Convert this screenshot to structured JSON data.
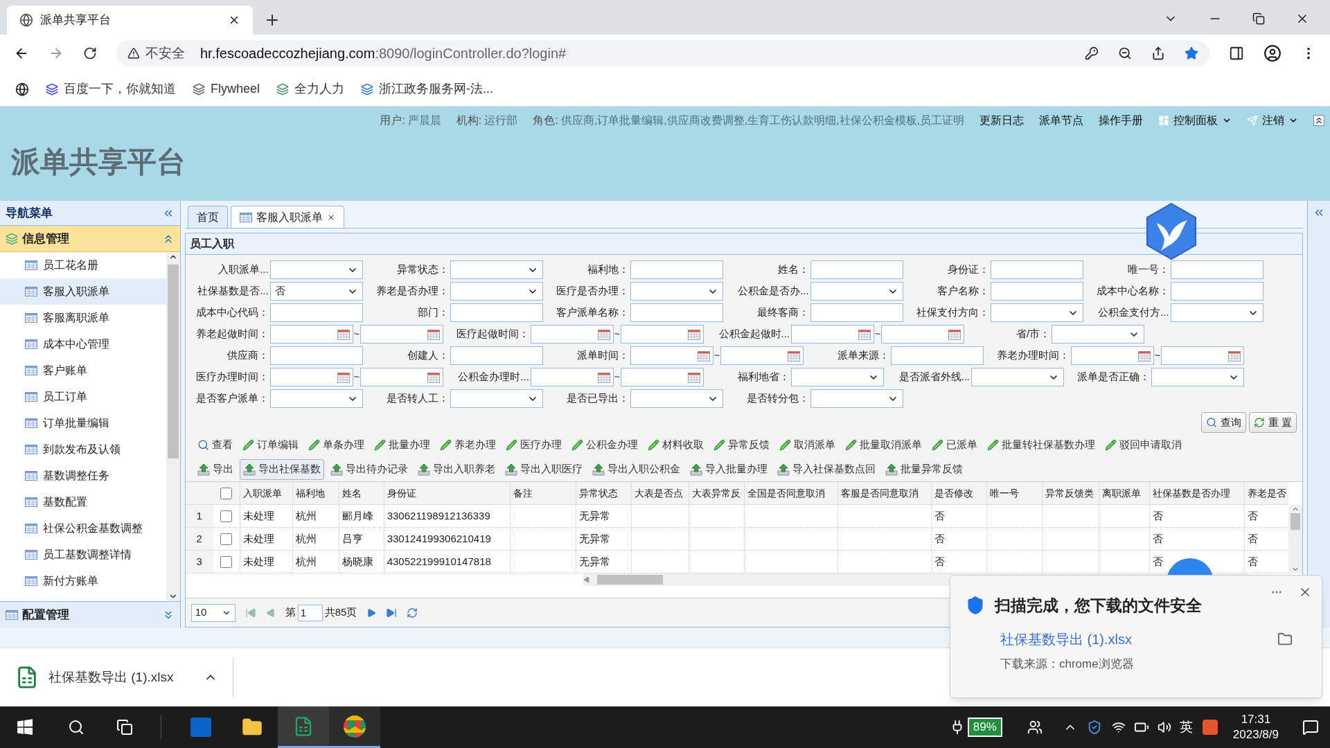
{
  "browser": {
    "tab_title": "派单共享平台",
    "security": "不安全",
    "url_host": "hr.fescoadeccozhejiang.com",
    "url_rest": ":8090/loginController.do?login#",
    "bookmarks": [
      "百度一下，你就知道",
      "Flywheel",
      "全力人力",
      "浙江政务服务网-法..."
    ]
  },
  "header": {
    "title": "派单共享平台",
    "info": [
      {
        "label": "用户:",
        "value": "严晨晨"
      },
      {
        "label": "机构:",
        "value": "运行部"
      },
      {
        "label": "角色:",
        "value": "供应商,订单批量编辑,供应商改费调整,生育工伤认款明细,社保公积金模板,员工证明"
      }
    ],
    "links": [
      {
        "label": "更新日志",
        "kind": "plain"
      },
      {
        "label": "派单节点",
        "kind": "plain"
      },
      {
        "label": "操作手册",
        "kind": "plain"
      },
      {
        "label": "控制面板",
        "kind": "panel"
      },
      {
        "label": "注销",
        "kind": "logout"
      }
    ]
  },
  "sidebar": {
    "title": "导航菜单",
    "groups": [
      {
        "label": "信息管理",
        "expanded": true,
        "items": [
          {
            "label": "员工花名册",
            "selected": false
          },
          {
            "label": "客服入职派单",
            "selected": true
          },
          {
            "label": "客服离职派单",
            "selected": false
          },
          {
            "label": "成本中心管理",
            "selected": false
          },
          {
            "label": "客户账单",
            "selected": false
          },
          {
            "label": "员工订单",
            "selected": false
          },
          {
            "label": "订单批量编辑",
            "selected": false
          },
          {
            "label": "到款发布及认领",
            "selected": false
          },
          {
            "label": "基数调整任务",
            "selected": false
          },
          {
            "label": "基数配置",
            "selected": false
          },
          {
            "label": "社保公积金基数调整",
            "selected": false
          },
          {
            "label": "员工基数调整详情",
            "selected": false
          },
          {
            "label": "新付方账单",
            "selected": false
          }
        ]
      },
      {
        "label": "配置管理",
        "expanded": false
      }
    ]
  },
  "tabs": [
    {
      "label": "首页",
      "selected": false,
      "closable": false
    },
    {
      "label": "客服入职派单",
      "selected": true,
      "closable": true
    }
  ],
  "panel": {
    "title": "员工入职",
    "form_rows": [
      [
        {
          "label": "入职派单...",
          "kind": "select"
        },
        {
          "label": "异常状态：",
          "kind": "select"
        },
        {
          "label": "福利地：",
          "kind": "text"
        },
        {
          "label": "姓名：",
          "kind": "text"
        },
        {
          "label": "身份证：",
          "kind": "text"
        },
        {
          "label": "唯一号：",
          "kind": "text"
        }
      ],
      [
        {
          "label": "社保基数是否...",
          "kind": "select",
          "value": "否"
        },
        {
          "label": "养老是否办理：",
          "kind": "select"
        },
        {
          "label": "医疗是否办理：",
          "kind": "select"
        },
        {
          "label": "公积金是否办...",
          "kind": "select"
        },
        {
          "label": "客户名称：",
          "kind": "text"
        },
        {
          "label": "成本中心名称：",
          "kind": "text"
        }
      ],
      [
        {
          "label": "成本中心代码：",
          "kind": "text"
        },
        {
          "label": "部门：",
          "kind": "text"
        },
        {
          "label": "客户派单名称：",
          "kind": "text"
        },
        {
          "label": "最终客商：",
          "kind": "text"
        },
        {
          "label": "社保支付方向：",
          "kind": "select"
        },
        {
          "label": "公积金支付方...",
          "kind": "select"
        }
      ],
      [
        {
          "label": "养老起做时间：",
          "kind": "daterange",
          "separator": "~"
        },
        {
          "label": "医疗起做时间：",
          "kind": "daterange",
          "separator": "~"
        },
        {
          "label": "公积金起做时...",
          "kind": "daterange",
          "separator": "~"
        },
        {
          "label": "省/市：",
          "kind": "select"
        }
      ],
      [
        {
          "label": "供应商：",
          "kind": "text"
        },
        {
          "label": "创建人：",
          "kind": "text"
        },
        {
          "label": "派单时间：",
          "kind": "daterange",
          "separator": "~"
        },
        {
          "label": "派单来源：",
          "kind": "text"
        },
        {
          "label": "养老办理时间：",
          "kind": "daterange",
          "separator": "~"
        }
      ],
      [
        {
          "label": "医疗办理时间：",
          "kind": "daterange",
          "separator": "~"
        },
        {
          "label": "公积金办理时...",
          "kind": "daterange",
          "separator": "~"
        },
        {
          "label": "福利地省：",
          "kind": "select"
        },
        {
          "label": "是否派省外线...",
          "kind": "select"
        },
        {
          "label": "派单是否正确：",
          "kind": "select"
        }
      ],
      [
        {
          "label": "是否客户派单：",
          "kind": "select"
        },
        {
          "label": "是否转人工：",
          "kind": "select"
        },
        {
          "label": "是否已导出：",
          "kind": "select"
        },
        {
          "label": "是否转分包：",
          "kind": "select"
        }
      ]
    ],
    "form_buttons": [
      {
        "label": "查询",
        "kind": "search"
      },
      {
        "label": "重 置",
        "kind": "reset"
      }
    ],
    "toolbar_rows": [
      [
        {
          "label": "查看",
          "kind": "view",
          "focused": false
        },
        {
          "label": "订单编辑",
          "kind": "edit",
          "focused": false
        },
        {
          "label": "单条办理",
          "kind": "edit",
          "focused": false
        },
        {
          "label": "批量办理",
          "kind": "edit",
          "focused": false
        },
        {
          "label": "养老办理",
          "kind": "edit",
          "focused": false
        },
        {
          "label": "医疗办理",
          "kind": "edit",
          "focused": false
        },
        {
          "label": "公积金办理",
          "kind": "edit",
          "focused": false
        },
        {
          "label": "材料收取",
          "kind": "edit",
          "focused": false
        },
        {
          "label": "异常反馈",
          "kind": "edit",
          "focused": false
        },
        {
          "label": "取消派单",
          "kind": "edit",
          "focused": false
        },
        {
          "label": "批量取消派单",
          "kind": "edit",
          "focused": false
        },
        {
          "label": "已派单",
          "kind": "edit",
          "focused": false
        },
        {
          "label": "批量转社保基数办理",
          "kind": "edit",
          "focused": false
        },
        {
          "label": "驳回申请取消",
          "kind": "edit",
          "focused": false
        }
      ],
      [
        {
          "label": "导出",
          "kind": "export",
          "focused": false
        },
        {
          "label": "导出社保基数",
          "kind": "export",
          "focused": true
        },
        {
          "label": "导出待办记录",
          "kind": "export",
          "focused": false
        },
        {
          "label": "导出入职养老",
          "kind": "export",
          "focused": false
        },
        {
          "label": "导出入职医疗",
          "kind": "export",
          "focused": false
        },
        {
          "label": "导出入职公积金",
          "kind": "export",
          "focused": false
        },
        {
          "label": "导入批量办理",
          "kind": "export",
          "focused": false
        },
        {
          "label": "导入社保基数点回",
          "kind": "export",
          "focused": false
        },
        {
          "label": "批量异常反馈",
          "kind": "export",
          "focused": false
        }
      ]
    ],
    "table": {
      "all_checked": false,
      "columns": [
        "入职派单",
        "福利地",
        "姓名",
        "身份证",
        "备注",
        "异常状态",
        "大表是否点",
        "大表异常反",
        "全国是否同意取消",
        "客服是否同意取消",
        "是否修改",
        "唯一号",
        "异常反馈类",
        "离职派单",
        "社保基数是否办理",
        "养老是否"
      ],
      "rows": [
        {
          "no": "1",
          "checked": false,
          "cells": [
            "未处理",
            "杭州",
            "郦月峰",
            "330621198912136339",
            null,
            "无异常",
            null,
            null,
            null,
            null,
            "否",
            null,
            null,
            null,
            "否",
            "否"
          ]
        },
        {
          "no": "2",
          "checked": false,
          "cells": [
            "未处理",
            "杭州",
            "吕亨",
            "330124199306210419",
            null,
            "无异常",
            null,
            null,
            null,
            null,
            "否",
            null,
            null,
            null,
            "否",
            "否"
          ]
        },
        {
          "no": "3",
          "checked": false,
          "cells": [
            "未处理",
            "杭州",
            "杨晓康",
            "430522199910147818",
            null,
            "无异常",
            null,
            null,
            null,
            null,
            "否",
            null,
            null,
            null,
            "否",
            "否"
          ]
        }
      ]
    },
    "pager": {
      "page_size": "10",
      "page_prefix": "第",
      "page": "1",
      "page_total": "共85页"
    }
  },
  "download_bar": {
    "file": "社保基数导出 (1).xlsx"
  },
  "notification": {
    "title": "扫描完成，您下载的文件安全",
    "file": "社保基数导出 (1).xlsx",
    "source": "下载来源：chrome浏览器"
  },
  "taskbar": {
    "battery": "89%",
    "ime": "英",
    "time": "17:31",
    "date": "2023/8/9"
  }
}
